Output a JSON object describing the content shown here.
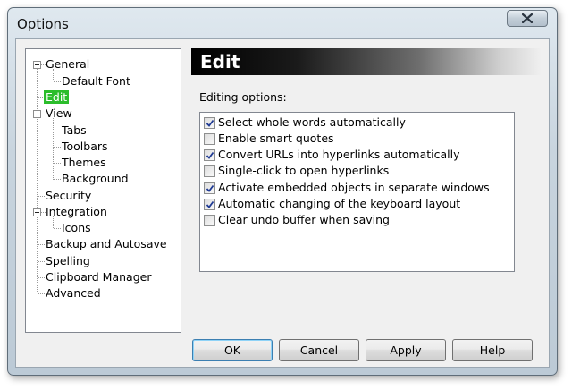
{
  "window": {
    "title": "Options"
  },
  "tree": {
    "items": [
      {
        "label": "General",
        "expanded": true
      },
      {
        "label": "Default Font"
      },
      {
        "label": "Edit",
        "selected": true
      },
      {
        "label": "View",
        "expanded": true
      },
      {
        "label": "Tabs"
      },
      {
        "label": "Toolbars"
      },
      {
        "label": "Themes"
      },
      {
        "label": "Background"
      },
      {
        "label": "Security"
      },
      {
        "label": "Integration",
        "expanded": true
      },
      {
        "label": "Icons"
      },
      {
        "label": "Backup and Autosave"
      },
      {
        "label": "Spelling"
      },
      {
        "label": "Clipboard Manager"
      },
      {
        "label": "Advanced"
      }
    ]
  },
  "panel": {
    "title": "Edit",
    "group_label": "Editing options:",
    "options": [
      {
        "label": "Select whole words automatically",
        "checked": true
      },
      {
        "label": "Enable smart quotes",
        "checked": false
      },
      {
        "label": "Convert URLs into hyperlinks automatically",
        "checked": true
      },
      {
        "label": "Single-click to open hyperlinks",
        "checked": false
      },
      {
        "label": "Activate embedded objects in separate windows",
        "checked": true
      },
      {
        "label": "Automatic changing of the keyboard layout",
        "checked": true
      },
      {
        "label": "Clear undo buffer when saving",
        "checked": false
      }
    ]
  },
  "buttons": {
    "ok": "OK",
    "cancel": "Cancel",
    "apply": "Apply",
    "help": "Help"
  },
  "colors": {
    "selection": "#2bbd2b",
    "header_start": "#000000",
    "header_end": "#f0f0f0"
  }
}
